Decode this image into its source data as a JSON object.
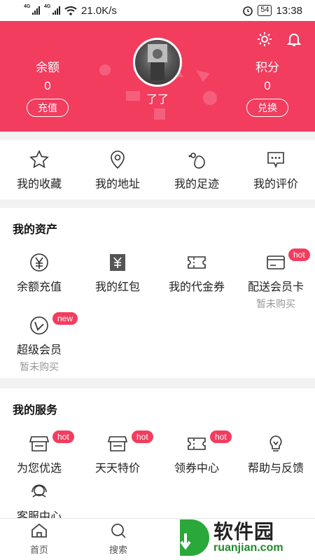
{
  "status_bar": {
    "net1": "4G",
    "net2": "4G",
    "speed": "21.0K/s",
    "battery": "54",
    "time": "13:38"
  },
  "header": {
    "balance": {
      "label": "余额",
      "value": "0",
      "button": "充值"
    },
    "points": {
      "label": "积分",
      "value": "0",
      "button": "兑换"
    },
    "username": "了了",
    "colors": {
      "brand": "#f23d5e"
    }
  },
  "quick": [
    {
      "label": "我的收藏",
      "icon": "star-icon"
    },
    {
      "label": "我的地址",
      "icon": "location-pin-icon"
    },
    {
      "label": "我的足迹",
      "icon": "footprint-icon"
    },
    {
      "label": "我的评价",
      "icon": "comment-icon"
    }
  ],
  "assets": {
    "title": "我的资产",
    "items": [
      {
        "label": "余额充值",
        "icon": "yen-circle-icon"
      },
      {
        "label": "我的红包",
        "icon": "red-packet-icon"
      },
      {
        "label": "我的代金券",
        "icon": "coupon-icon"
      },
      {
        "label": "配送会员卡",
        "icon": "card-icon",
        "badge": "hot",
        "sub": "暂未购买"
      },
      {
        "label": "超级会员",
        "icon": "vip-icon",
        "badge": "new",
        "sub": "暂未购买"
      }
    ]
  },
  "services": {
    "title": "我的服务",
    "items": [
      {
        "label": "为您优选",
        "icon": "shop-icon",
        "badge": "hot"
      },
      {
        "label": "天天特价",
        "icon": "shop-icon",
        "badge": "hot"
      },
      {
        "label": "领券中心",
        "icon": "coupon-icon",
        "badge": "hot"
      },
      {
        "label": "帮助与反馈",
        "icon": "lightbulb-icon"
      },
      {
        "label": "客服中心",
        "icon": "headset-icon"
      }
    ]
  },
  "tabbar": [
    {
      "label": "首页",
      "icon": "home-icon"
    },
    {
      "label": "搜索",
      "icon": "search-icon"
    }
  ],
  "watermark": {
    "text": "软件园",
    "url": "ruanjian.com"
  }
}
